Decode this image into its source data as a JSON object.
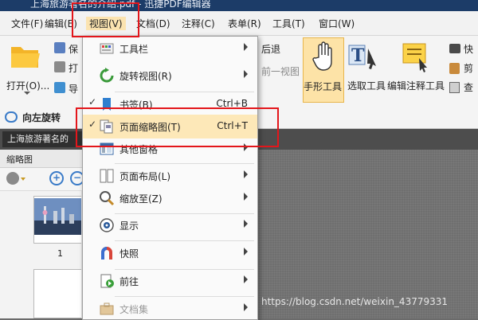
{
  "window": {
    "title": "上海旅游著名的介绍.pdf - 迅捷PDF编辑器"
  },
  "menubar": {
    "items": [
      {
        "label": "文件(F)"
      },
      {
        "label": "编辑(E)"
      },
      {
        "label": "视图(V)"
      },
      {
        "label": "文档(D)"
      },
      {
        "label": "注释(C)"
      },
      {
        "label": "表单(R)"
      },
      {
        "label": "工具(T)"
      },
      {
        "label": "窗口(W)"
      }
    ]
  },
  "ribbon": {
    "open_label": "打开(O)...",
    "partial_labels": [
      "保",
      "打",
      "导"
    ],
    "back_label": "后退",
    "prev_view_label": "前一视图",
    "hand_tool_label": "手形工具",
    "select_text_label": "选取工具",
    "edit_annot_label": "编辑注释工具",
    "right_partial_labels": [
      "快",
      "剪",
      "查"
    ]
  },
  "subbar": {
    "rotate_left_label": "向左旋转"
  },
  "document": {
    "tab_title": "上海旅游著名的"
  },
  "thumbnail_panel": {
    "title": "缩略图",
    "page_number": "1"
  },
  "view_menu": {
    "items": [
      {
        "label": "工具栏",
        "shortcut": "",
        "submenu": true,
        "checked": false,
        "icon": "toolbar-icon"
      },
      {
        "label": "旋转视图(R)",
        "shortcut": "",
        "submenu": true,
        "checked": false,
        "icon": "rotate-view-icon"
      },
      {
        "label": "书签(B)",
        "shortcut": "Ctrl+B",
        "submenu": false,
        "checked": true,
        "icon": "bookmark-icon"
      },
      {
        "label": "页面缩略图(T)",
        "shortcut": "Ctrl+T",
        "submenu": false,
        "checked": true,
        "icon": "page-thumbnail-icon"
      },
      {
        "label": "其他窗格",
        "shortcut": "",
        "submenu": true,
        "checked": false,
        "icon": "other-panes-icon"
      },
      {
        "label": "页面布局(L)",
        "shortcut": "",
        "submenu": true,
        "checked": false,
        "icon": "page-layout-icon"
      },
      {
        "label": "缩放至(Z)",
        "shortcut": "",
        "submenu": true,
        "checked": false,
        "icon": "zoom-icon"
      },
      {
        "label": "显示",
        "shortcut": "",
        "submenu": true,
        "checked": false,
        "icon": "display-icon"
      },
      {
        "label": "快照",
        "shortcut": "",
        "submenu": true,
        "checked": false,
        "icon": "snapshot-icon"
      },
      {
        "label": "前往",
        "shortcut": "",
        "submenu": true,
        "checked": false,
        "icon": "goto-icon"
      },
      {
        "label": "文档集",
        "shortcut": "",
        "submenu": true,
        "checked": false,
        "icon": "document-set-icon"
      }
    ]
  },
  "watermark": "https://blog.csdn.net/weixin_43779331",
  "colors": {
    "menu_highlight": "#fde8b8",
    "annotation_red": "#e3161b",
    "title_bar": "#1c3c68"
  }
}
